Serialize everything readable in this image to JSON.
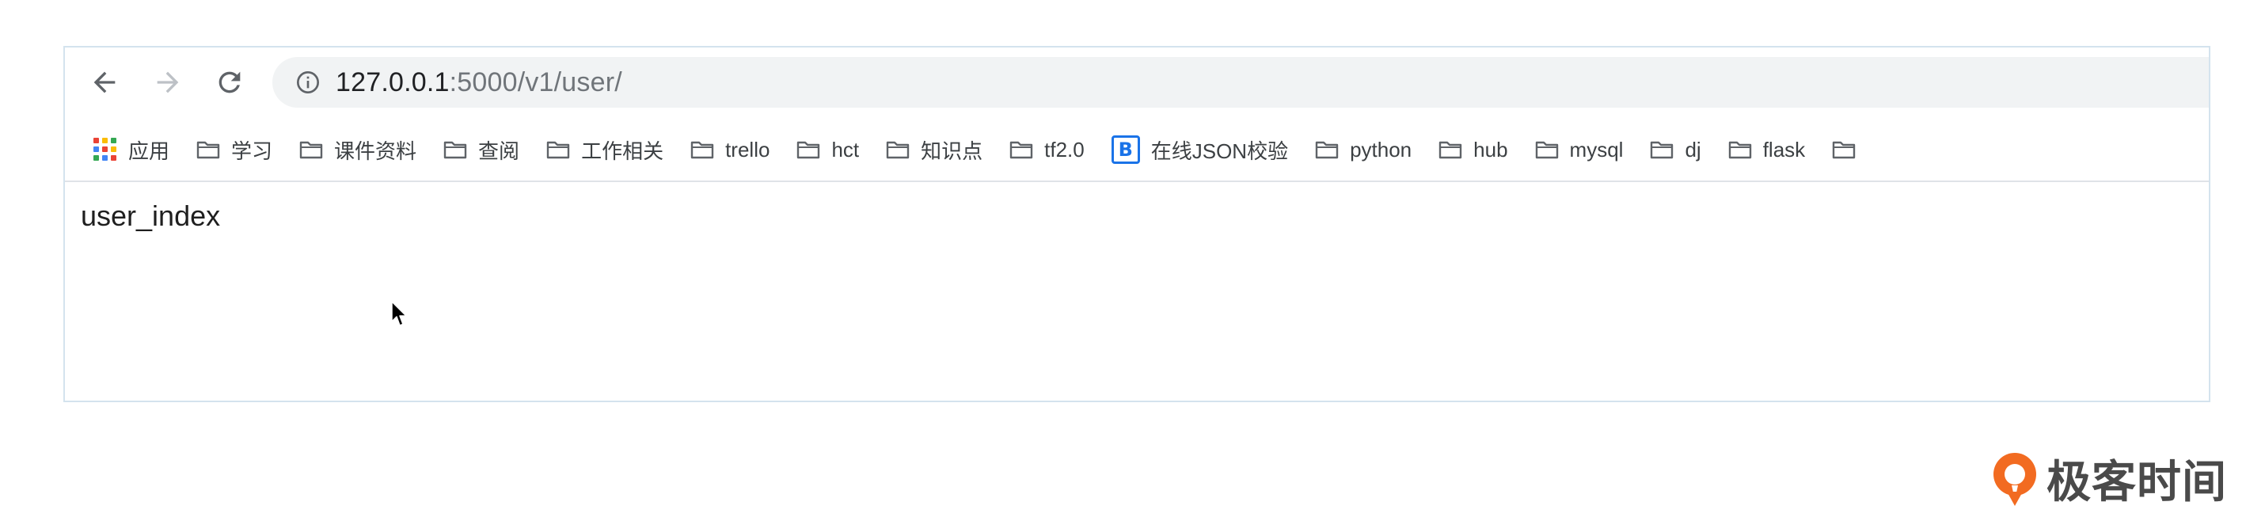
{
  "browser": {
    "url_host": "127.0.0.1",
    "url_path": ":5000/v1/user/"
  },
  "bookmarks": [
    {
      "label": "应用",
      "icon": "apps-grid-icon"
    },
    {
      "label": "学习",
      "icon": "folder-icon"
    },
    {
      "label": "课件资料",
      "icon": "folder-icon"
    },
    {
      "label": "查阅",
      "icon": "folder-icon"
    },
    {
      "label": "工作相关",
      "icon": "folder-icon"
    },
    {
      "label": "trello",
      "icon": "folder-icon"
    },
    {
      "label": "hct",
      "icon": "folder-icon"
    },
    {
      "label": "知识点",
      "icon": "folder-icon"
    },
    {
      "label": "tf2.0",
      "icon": "folder-icon"
    },
    {
      "label": "在线JSON校验",
      "icon": "b-badge-icon",
      "badge_letter": "B"
    },
    {
      "label": "python",
      "icon": "folder-icon"
    },
    {
      "label": "hub",
      "icon": "folder-icon"
    },
    {
      "label": "mysql",
      "icon": "folder-icon"
    },
    {
      "label": "dj",
      "icon": "folder-icon"
    },
    {
      "label": "flask",
      "icon": "folder-icon"
    },
    {
      "label": "",
      "icon": "folder-icon"
    }
  ],
  "page": {
    "body_text": "user_index"
  },
  "watermark": {
    "text": "极客时间",
    "accent_color": "#f26b21"
  },
  "colors": {
    "apps_grid": [
      "#ea4335",
      "#fbbc05",
      "#34a853",
      "#4285f4",
      "#ea4335",
      "#fbbc05",
      "#34a853",
      "#4285f4",
      "#ea4335"
    ]
  }
}
